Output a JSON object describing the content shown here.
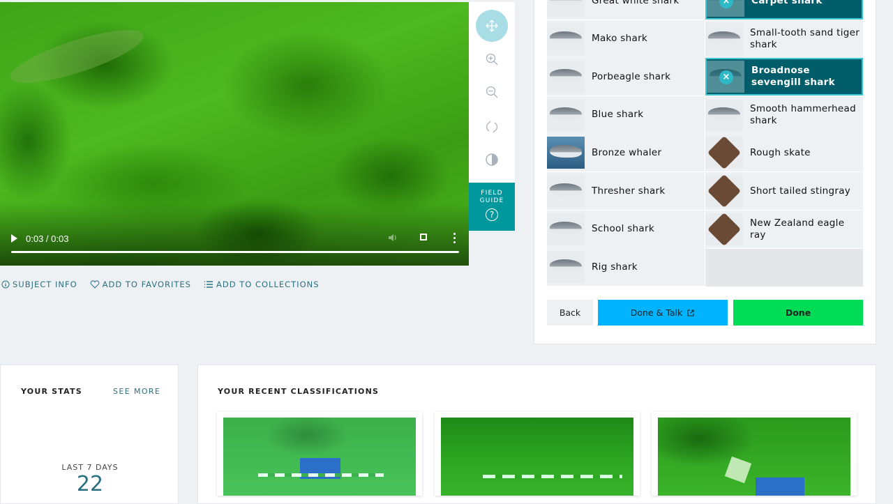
{
  "viewer": {
    "time": "0:03 / 0:03",
    "progress": 1.0
  },
  "toolbar": {
    "field_guide_line1": "FIELD",
    "field_guide_line2": "GUIDE",
    "field_guide_icon": "?"
  },
  "meta": {
    "subject_info": "SUBJECT INFO",
    "add_favorites": "ADD TO FAVORITES",
    "add_collections": "ADD TO COLLECTIONS"
  },
  "choices": [
    {
      "label": "Great white shark",
      "selected": false,
      "thumb": "shark"
    },
    {
      "label": "Carpet shark",
      "selected": true,
      "thumb": "shark"
    },
    {
      "label": "Mako shark",
      "selected": false,
      "thumb": "shark"
    },
    {
      "label": "Small-tooth sand tiger shark",
      "selected": false,
      "thumb": "shark"
    },
    {
      "label": "Porbeagle shark",
      "selected": false,
      "thumb": "shark"
    },
    {
      "label": "Broadnose sevengill shark",
      "selected": true,
      "thumb": "shark"
    },
    {
      "label": "Blue shark",
      "selected": false,
      "thumb": "shark"
    },
    {
      "label": "Smooth hammerhead shark",
      "selected": false,
      "thumb": "shark"
    },
    {
      "label": "Bronze whaler",
      "selected": false,
      "thumb": "ocean"
    },
    {
      "label": "Rough skate",
      "selected": false,
      "thumb": "ray"
    },
    {
      "label": "Thresher shark",
      "selected": false,
      "thumb": "shark"
    },
    {
      "label": "Short tailed stingray",
      "selected": false,
      "thumb": "ray"
    },
    {
      "label": "School shark",
      "selected": false,
      "thumb": "shark"
    },
    {
      "label": "New Zealand eagle ray",
      "selected": false,
      "thumb": "ray"
    },
    {
      "label": "Rig shark",
      "selected": false,
      "thumb": "shark"
    }
  ],
  "selected_marker": "×",
  "buttons": {
    "back": "Back",
    "done_talk": "Done & Talk",
    "done": "Done"
  },
  "stats": {
    "title": "YOUR STATS",
    "see_more": "SEE MORE",
    "period": "LAST 7 DAYS",
    "count": "22"
  },
  "recent": {
    "title": "YOUR RECENT CLASSIFICATIONS"
  },
  "colors": {
    "teal": "#005d69",
    "talk_blue": "#00b3ff",
    "done_green": "#00dc55",
    "link": "#2b6f80"
  }
}
